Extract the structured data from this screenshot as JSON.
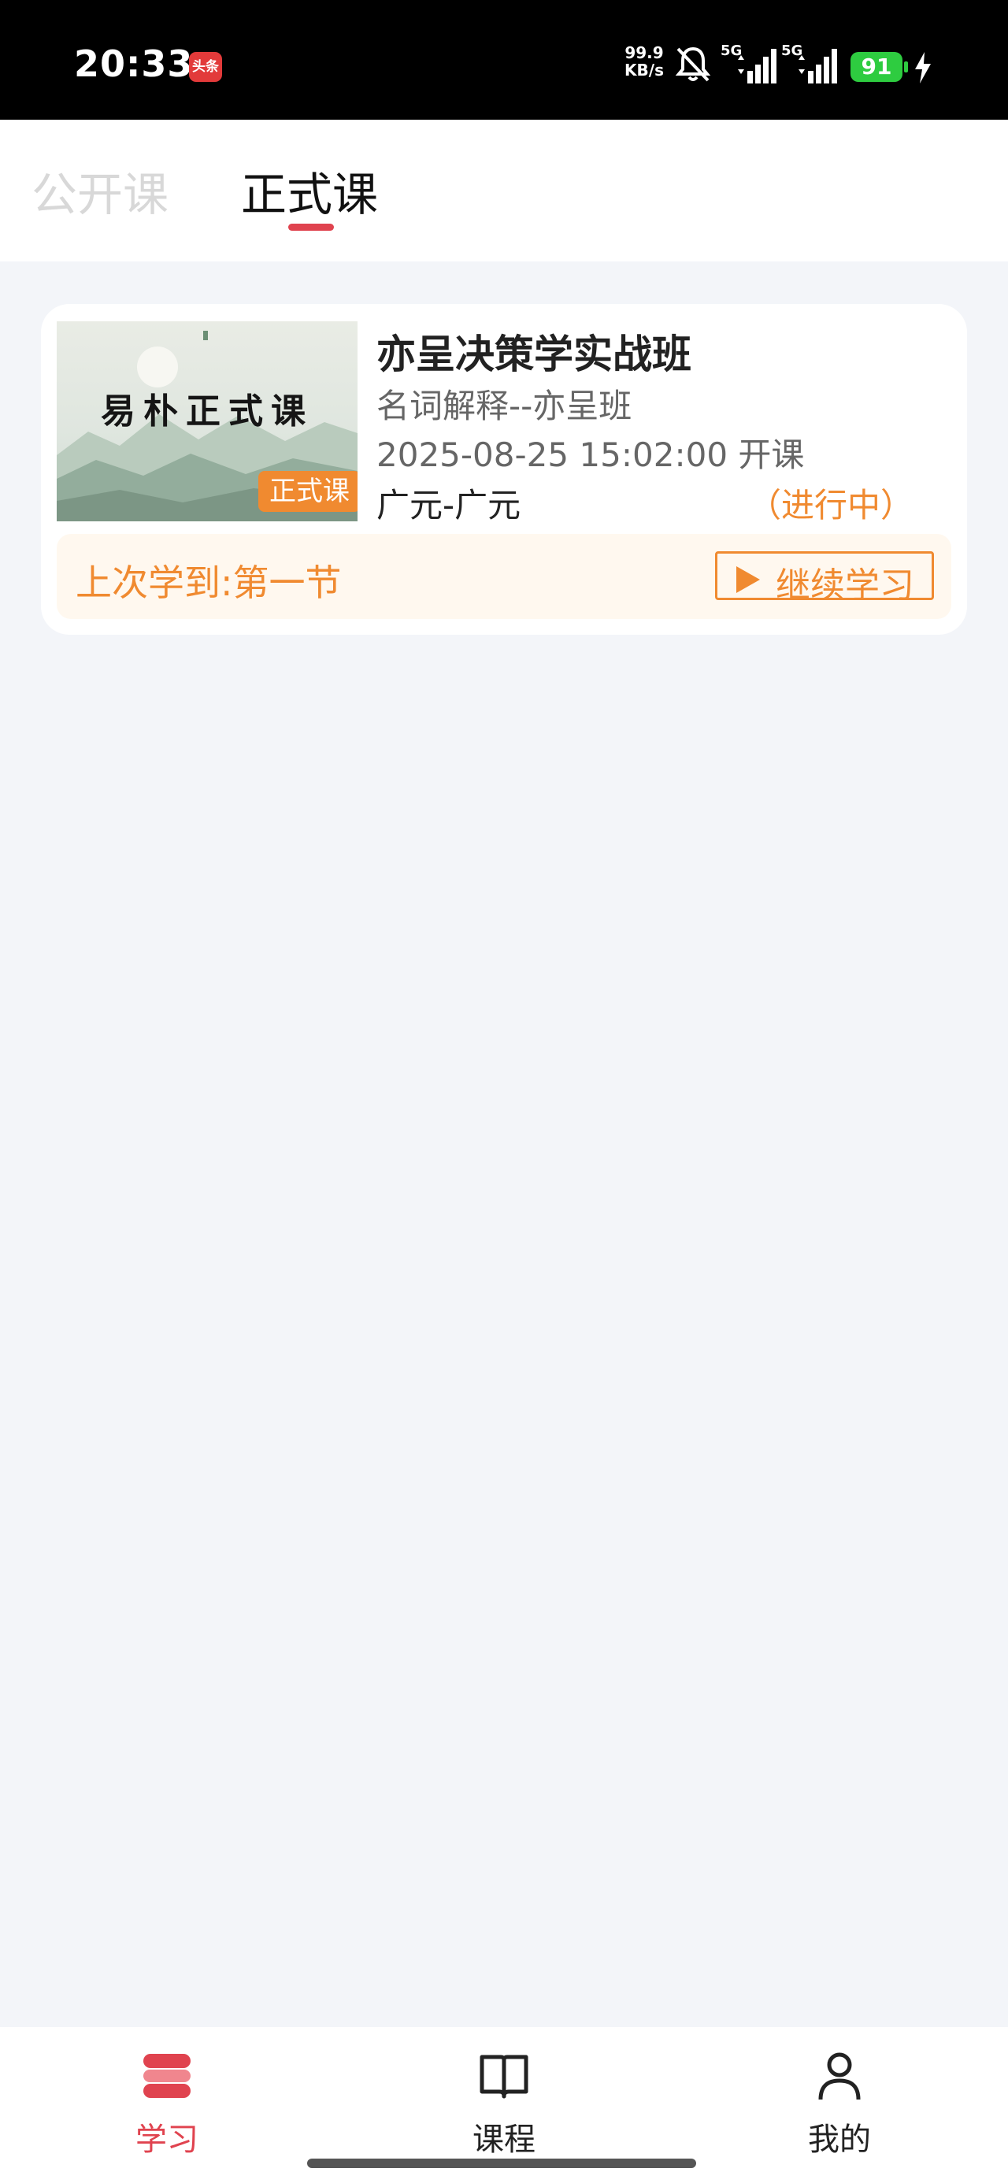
{
  "status_bar": {
    "time": "20:33",
    "app_badge": "头条",
    "speed_value": "99.9",
    "speed_unit": "KB/s",
    "signal_1_label": "5G",
    "signal_2_label": "5G",
    "battery": "91"
  },
  "tabs": [
    {
      "label": "公开课",
      "active": false
    },
    {
      "label": "正式课",
      "active": true
    }
  ],
  "course": {
    "thumbnail_title": "易朴正式课",
    "thumbnail_tag": "正式课",
    "title": "亦呈决策学实战班",
    "subtitle": "名词解释--亦呈班",
    "start_time": "2025-08-25 15:02:00 开课",
    "location": "广元-广元",
    "status": "（进行中）",
    "last_learned": "上次学到:第一节",
    "continue_label": "继续学习"
  },
  "bottom_nav": [
    {
      "label": "学习",
      "icon": "study-icon",
      "active": true
    },
    {
      "label": "课程",
      "icon": "book-icon",
      "active": false
    },
    {
      "label": "我的",
      "icon": "user-icon",
      "active": false
    }
  ],
  "colors": {
    "accent": "#e0434f",
    "orange": "#f08a30",
    "background": "#f3f5f9"
  }
}
